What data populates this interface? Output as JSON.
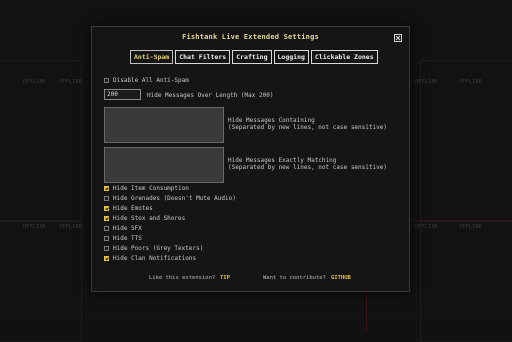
{
  "background": {
    "labels": [
      "OFFLINE",
      "OFFLINE",
      "OFFLINE",
      "OFFLINE",
      "OFFLINE",
      "OFFLINE",
      "OFFLINE",
      "OFFLINE",
      "OFFLINE",
      "OFFLINE"
    ]
  },
  "modal": {
    "title": "Fishtank Live Extended Settings",
    "tabs": [
      {
        "label": "Anti-Spam",
        "active": true
      },
      {
        "label": "Chat Filters",
        "active": false
      },
      {
        "label": "Crafting",
        "active": false
      },
      {
        "label": "Logging",
        "active": false
      },
      {
        "label": "Clickable Zones",
        "active": false
      }
    ],
    "disable_all": {
      "label": "Disable All Anti-Spam",
      "checked": false
    },
    "max_length": {
      "value": "200",
      "label": "Hide Messages Over Length (Max 200)"
    },
    "containing": {
      "label": "Hide Messages Containing",
      "hint": "(Separated by new lines, not case sensitive)",
      "value": ""
    },
    "exact": {
      "label": "Hide Messages Exactly Matching",
      "hint": "(Separated by new lines, not case sensitive)",
      "value": ""
    },
    "options": [
      {
        "label": "Hide Item Consumption",
        "checked": true
      },
      {
        "label": "Hide Grenades (Doesn't Mute Audio)",
        "checked": false
      },
      {
        "label": "Hide Emotes",
        "checked": true
      },
      {
        "label": "Hide Stox and Shores",
        "checked": true
      },
      {
        "label": "Hide SFX",
        "checked": false
      },
      {
        "label": "Hide TTS",
        "checked": false
      },
      {
        "label": "Hide Poors (Grey Texters)",
        "checked": false
      },
      {
        "label": "Hide Clan Notifications",
        "checked": true
      }
    ],
    "footer": {
      "tip_prompt": "Like this extension?",
      "tip_link": "TIP",
      "contribute_prompt": "Want to contribute?",
      "github_link": "GITHUB"
    }
  },
  "colors": {
    "accent": "#e3c34a",
    "title": "#e2d89a"
  },
  "icons": {
    "close": "close-icon"
  }
}
